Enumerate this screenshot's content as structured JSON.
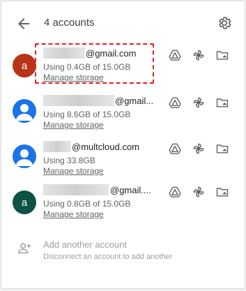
{
  "header": {
    "title": "4 accounts"
  },
  "accounts": [
    {
      "email_suffix": "@gmail.com",
      "usage": "Using 0.4GB of 15.0GB",
      "manage": "Manage storage",
      "avatar_letter": "a",
      "avatar_color": "#b7341a"
    },
    {
      "email_suffix": "@gmail...",
      "usage": "Using 8.6GB of 15.0GB",
      "manage": "Manage storage",
      "avatar_letter": "",
      "avatar_color": "#1a73e8"
    },
    {
      "email_suffix": "@multcloud.com",
      "usage": "Using 33.8GB",
      "manage": "Manage storage",
      "avatar_letter": "",
      "avatar_color": "#1a73e8"
    },
    {
      "email_suffix": "@gmail....",
      "usage": "Using 0.8GB of 15.0GB",
      "manage": "Manage storage",
      "avatar_letter": "a",
      "avatar_color": "#0b5345"
    }
  ],
  "add_account": {
    "title": "Add another account",
    "subtitle": "Disconnect an account to add another"
  },
  "colors": {
    "icon": "#5f6368",
    "highlight": "#e02020"
  }
}
